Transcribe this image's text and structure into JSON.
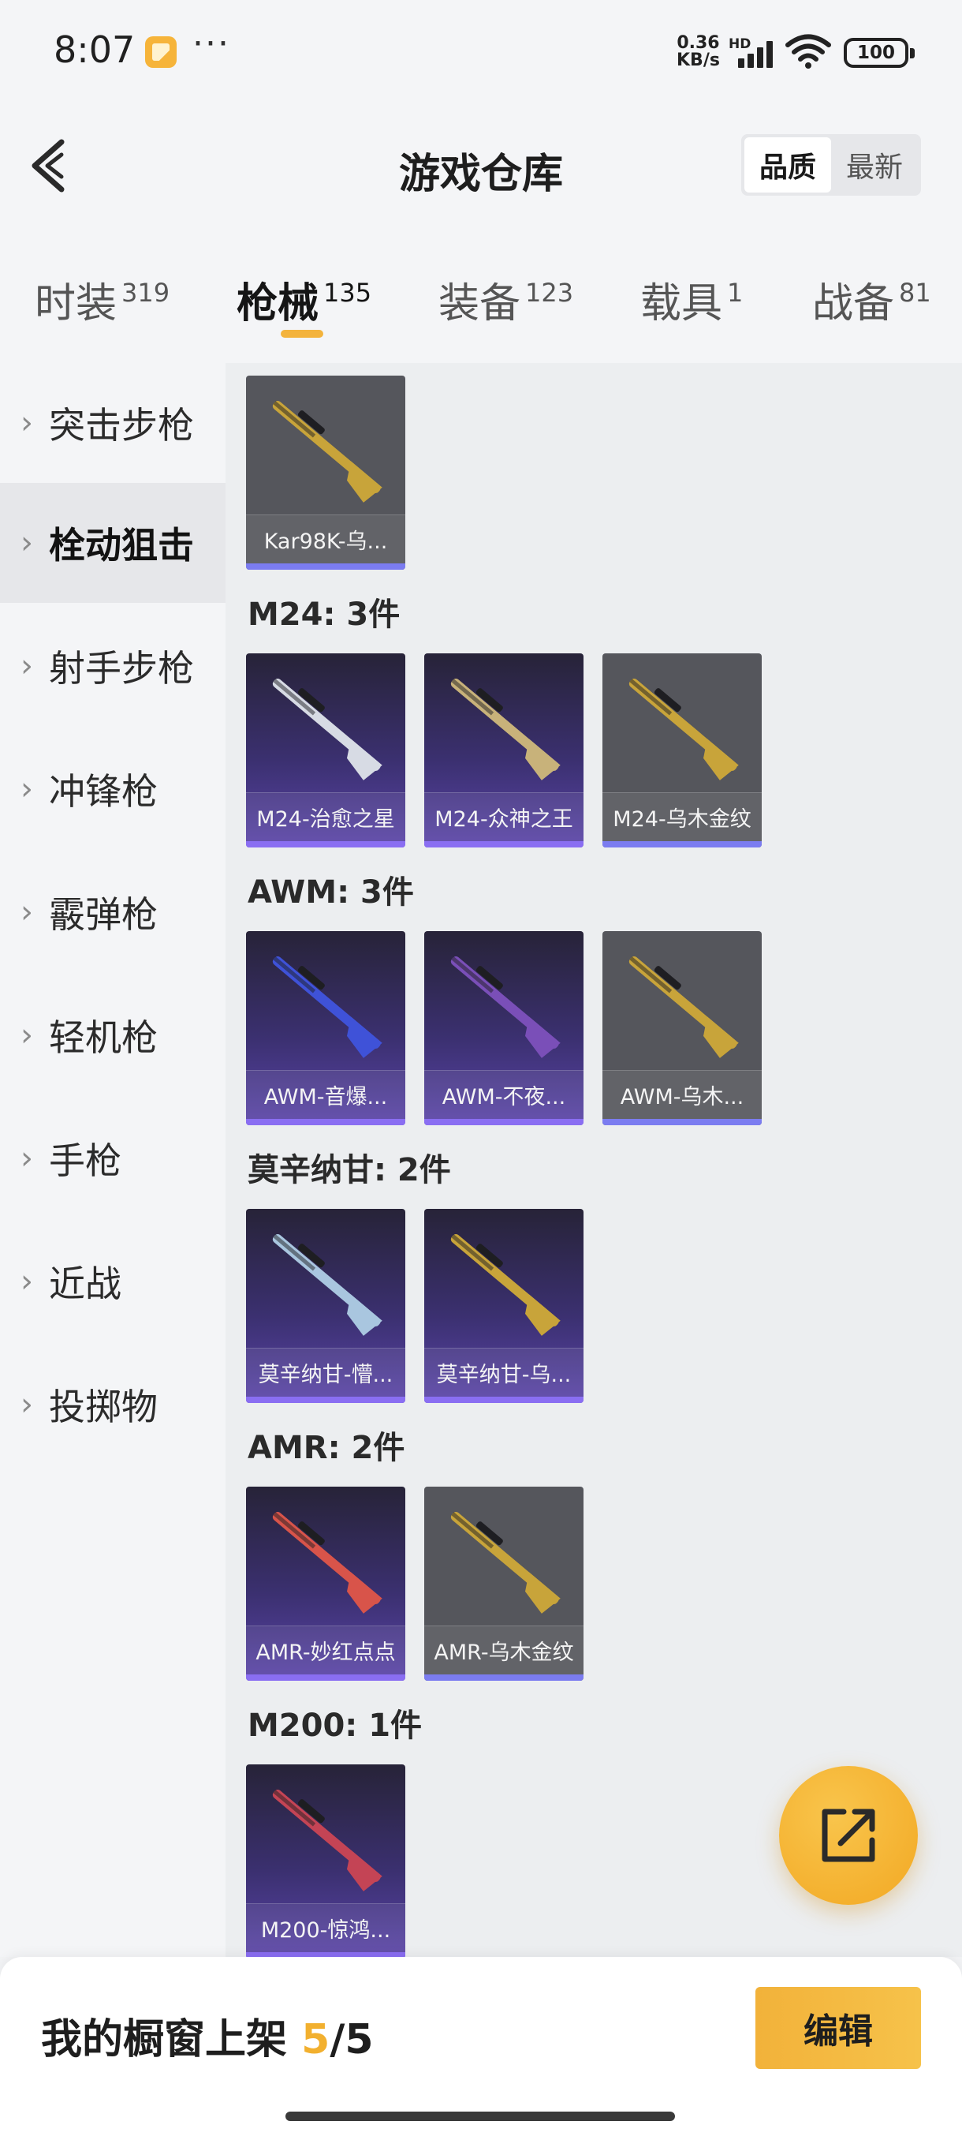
{
  "status_bar": {
    "time": "8:07",
    "dots": "···",
    "speed_value": "0.36",
    "speed_unit": "KB/s",
    "hd": "HD",
    "battery": "100"
  },
  "header": {
    "title": "游戏仓库",
    "sort_quality": "品质",
    "sort_latest": "最新"
  },
  "tabs": [
    {
      "label": "时装",
      "count": "319"
    },
    {
      "label": "枪械",
      "count": "135",
      "active": true
    },
    {
      "label": "装备",
      "count": "123"
    },
    {
      "label": "载具",
      "count": "1"
    },
    {
      "label": "战备",
      "count": "81"
    }
  ],
  "sidebar": [
    {
      "label": "突击步枪"
    },
    {
      "label": "栓动狙击",
      "active": true
    },
    {
      "label": "射手步枪"
    },
    {
      "label": "冲锋枪"
    },
    {
      "label": "霰弹枪"
    },
    {
      "label": "轻机枪"
    },
    {
      "label": "手枪"
    },
    {
      "label": "近战"
    },
    {
      "label": "投掷物"
    }
  ],
  "groups": [
    {
      "title": "",
      "items": [
        {
          "name": "Kar98K-乌...",
          "rarity": "normal",
          "color": "#c8a43a"
        }
      ]
    },
    {
      "title": "M24: 3件",
      "items": [
        {
          "name": "M24-治愈之星",
          "rarity": "legendary",
          "color": "#d7dbe4"
        },
        {
          "name": "M24-众神之王",
          "rarity": "legendary",
          "color": "#c8b27a"
        },
        {
          "name": "M24-乌木金纹",
          "rarity": "normal",
          "color": "#c8a43a"
        }
      ]
    },
    {
      "title": "AWM: 3件",
      "items": [
        {
          "name": "AWM-音爆...",
          "rarity": "legendary",
          "color": "#3f52d8"
        },
        {
          "name": "AWM-不夜...",
          "rarity": "legendary",
          "color": "#7a4fb8"
        },
        {
          "name": "AWM-乌木...",
          "rarity": "normal",
          "color": "#c8a43a"
        }
      ]
    },
    {
      "title": "莫辛纳甘: 2件",
      "items": [
        {
          "name": "莫辛纳甘-懵...",
          "rarity": "legendary",
          "color": "#a9c6df"
        },
        {
          "name": "莫辛纳甘-乌...",
          "rarity": "legendary",
          "color": "#c8a43a"
        }
      ]
    },
    {
      "title": "AMR: 2件",
      "items": [
        {
          "name": "AMR-妙红点点",
          "rarity": "legendary",
          "color": "#d8544a"
        },
        {
          "name": "AMR-乌木金纹",
          "rarity": "normal",
          "color": "#c8a43a"
        }
      ]
    },
    {
      "title": "M200: 1件",
      "items": [
        {
          "name": "M200-惊鸿...",
          "rarity": "legendary",
          "color": "#c44455"
        }
      ]
    }
  ],
  "bottom": {
    "label": "我的橱窗上架",
    "current": "5",
    "sep": "/",
    "total": "5",
    "edit_label": "编辑"
  },
  "icons": {
    "back": "back-arrow-icon",
    "share": "share-export-icon",
    "chevron": "chevron-right-icon"
  },
  "colors": {
    "accent": "#f2b02f",
    "legendary_card": "#3b3070",
    "normal_card": "#55565c"
  }
}
